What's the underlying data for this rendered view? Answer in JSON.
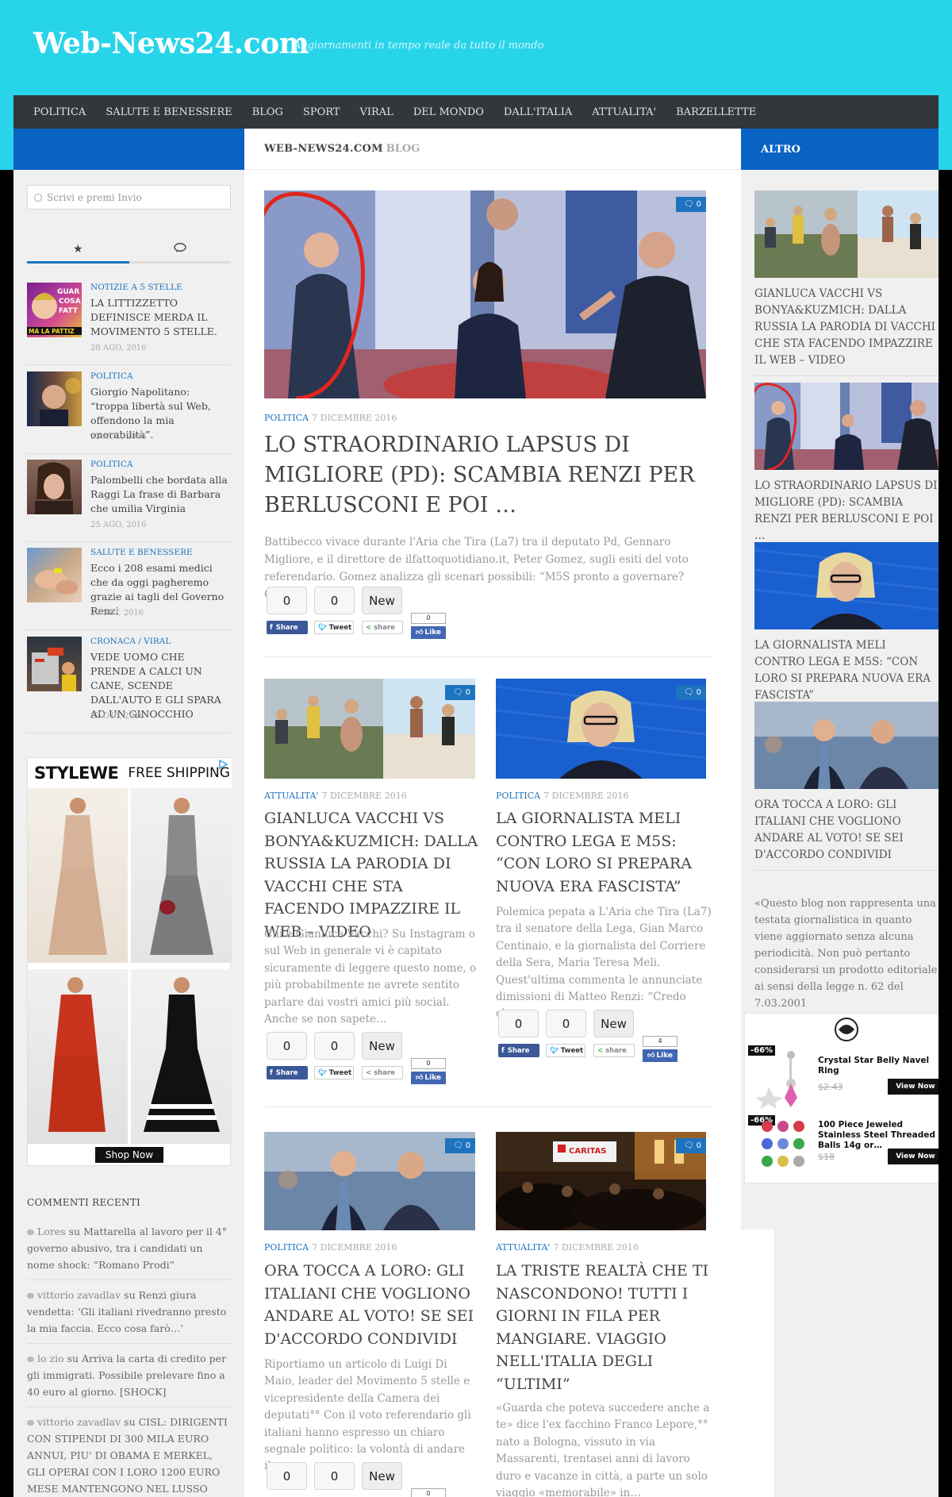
{
  "site": {
    "title": "Web-News24.com",
    "tagline": "Aggiornamenti in tempo reale da tutto il mondo"
  },
  "nav": [
    "POLITICA",
    "SALUTE E BENESSERE",
    "BLOG",
    "SPORT",
    "VIRAL",
    "DEL MONDO",
    "DALL'ITALIA",
    "ATTUALITA'",
    "BARZELLETTE"
  ],
  "main_header": {
    "site": "WEB-NEWS24.COM",
    "section": "BLOG"
  },
  "right_header": "ALTRO",
  "search": {
    "placeholder": "Scrivi e premi Invio"
  },
  "sidebar_posts": [
    {
      "category": "NOTIZIE A 5 STELLE",
      "title": "LA LITTIZZETTO DEFINISCE MERDA IL MOVIMENTO 5 STELLE.",
      "date": "28 AGO, 2016"
    },
    {
      "category": "POLITICA",
      "title": "Giorgio Napolitano: “troppa libertà sul Web, offendono la mia onorabilità”.",
      "date": "23 AGO, 2016"
    },
    {
      "category": "POLITICA",
      "title": "Palombelli che bordata alla Raggi La frase di Barbara che umilia Virginia",
      "date": "25 AGO, 2016"
    },
    {
      "category": "SALUTE E BENESSERE",
      "title": "Ecco i 208 esami medici che da oggi pagheremo grazie ai tagli del Governo Renzi",
      "date": "24 SET, 2016"
    },
    {
      "category": "CRONACA",
      "category2": "VIRAL",
      "title": "VEDE UOMO CHE PRENDE A CALCI UN CANE, SCENDE DALL'AUTO E GLI SPARA AD UN GINOCCHIO",
      "date": "27 OTT, 2016"
    }
  ],
  "ad_left": {
    "brand": "STYLEWE",
    "headline": "FREE SHIPPING",
    "cta": "Shop Now"
  },
  "recent_comments": {
    "heading": "COMMENTI RECENTI",
    "items": [
      {
        "author": "Lores",
        "sep": "su",
        "post": "Mattarella al lavoro per il 4° governo abusivo, tra i candidati un nome shock: “Romano Prodi”"
      },
      {
        "author": "vittorio zavadlav",
        "sep": "su",
        "post": "Renzi giura vendetta: ‘Gli italiani rivedranno presto la mia faccia. Ecco cosa farò…’"
      },
      {
        "author": "lo zio",
        "sep": "su",
        "post": "Arriva la carta di credito per gli immigrati. Possibile prelevare fino a 40 euro al giorno. [SHOCK]"
      },
      {
        "author": "vittorio zavadlav",
        "sep": "su",
        "post": "CISL: DIRIGENTI CON STIPENDI DI 300 MILA EURO ANNUI, PIU' DI OBAMA E MERKEL, GLI OPERAI CON I LORO 1200 EURO MESE MANTENGONO NEL LUSSO CHI"
      }
    ]
  },
  "posts": [
    {
      "comments": "0",
      "category": "POLITICA",
      "date": "7 DICEMBRE 2016",
      "title": "LO STRAORDINARIO LAPSUS DI MIGLIORE (PD): SCAMBIA RENZI PER BERLUSCONI E POI …",
      "excerpt": "Battibecco vivace durante l'Aria che Tira (La7) tra il deputato Pd, Gennaro Migliore, e il direttore de ilfattoquotidiano.it, Peter Gomez, sugli esiti del voto referendario. Gomez analizza gli scenari possibili: “M5S pronto a governare? Ora…",
      "share": {
        "c1": "0",
        "c2": "0",
        "new": "New",
        "fb": "Share",
        "tw": "Tweet",
        "sh": "share",
        "likes": "0",
        "like": "Like"
      }
    },
    {
      "comments": "0",
      "category": "ATTUALITA'",
      "date": "7 DICEMBRE 2016",
      "title": "GIANLUCA VACCHI VS BONYA&KUZMICH: DALLA RUSSIA LA PARODIA DI VACCHI CHE STA FACENDO IMPAZZIRE IL WEB – VIDEO",
      "excerpt": "Chi è Gianluca Vacchi? Su Instagram o sul Web in generale vi è capitato sicuramente di leggere questo nome, o più probabilmente ne avrete sentito parlare dai vostri amici più social. Anche se non sapete…",
      "share": {
        "c1": "0",
        "c2": "0",
        "new": "New",
        "fb": "Share",
        "tw": "Tweet",
        "sh": "share",
        "likes": "0",
        "like": "Like"
      }
    },
    {
      "comments": "0",
      "category": "POLITICA",
      "date": "7 DICEMBRE 2016",
      "title": "LA GIORNALISTA MELI CONTRO LEGA E M5S: “CON LORO SI PREPARA NUOVA ERA FASCISTA”",
      "excerpt": "Polemica pepata a L'Aria che Tira (La7) tra il senatore della Lega, Gian Marco Centinaio, e la giornalista del Corriere della Sera, Maria Teresa Meli. Quest'ultima commenta le annunciate dimissioni di Matteo Renzi: “Credo che…",
      "share": {
        "c1": "0",
        "c2": "0",
        "new": "New",
        "fb": "Share",
        "tw": "Tweet",
        "sh": "share",
        "likes": "4",
        "like": "Like"
      }
    },
    {
      "comments": "0",
      "category": "POLITICA",
      "date": "7 DICEMBRE 2016",
      "title": "ORA TOCCA A LORO: GLI ITALIANI CHE VOGLIONO ANDARE AL VOTO! SE SEI D'ACCORDO CONDIVIDI",
      "excerpt": "Riportiamo un articolo di Luigi Di Maio, leader del Movimento 5 stelle e vicepresidente della Camera dei deputati°° Con il voto referendario gli italiani hanno espresso un chiaro segnale politico: la volontà di andare il…",
      "share": {
        "c1": "0",
        "c2": "0",
        "new": "New",
        "likes": "0"
      }
    },
    {
      "comments": "0",
      "category": "ATTUALITA'",
      "date": "7 DICEMBRE 2016",
      "title": "LA TRISTE REALTÀ CHE TI NASCONDONO! TUTTI I GIORNI IN FILA PER MANGIARE. VIAGGIO NELL'ITALIA DEGLI “ULTIMI”",
      "excerpt": "«Guarda che poteva succedere anche a te» dice l'ex facchino Franco Lepore,°° nato a Bologna, vissuto in via Massarenti, trentasei anni di lavoro duro e vacanze in città, a parte un solo viaggio «memorabile» in…"
    }
  ],
  "right_posts": [
    {
      "title": "GIANLUCA VACCHI VS BONYA&KUZMICH: DALLA RUSSIA LA PARODIA DI VACCHI CHE STA FACENDO IMPAZZIRE IL WEB – VIDEO"
    },
    {
      "title": "LO STRAORDINARIO LAPSUS DI MIGLIORE (PD): SCAMBIA RENZI PER BERLUSCONI E POI …"
    },
    {
      "title": "LA GIORNALISTA MELI CONTRO LEGA E M5S: “CON LORO SI PREPARA NUOVA ERA FASCISTA”"
    },
    {
      "title": "ORA TOCCA A LORO: GLI ITALIANI CHE VOGLIONO ANDARE AL VOTO! SE SEI D'ACCORDO CONDIVIDI"
    }
  ],
  "disclaimer": "«Questo blog non rappresenta una testata giornalistica in quanto viene aggiornato senza alcuna periodicità. Non può pertanto considerarsi un prodotto editoriale ai sensi della legge n. 62 del 7.03.2001",
  "ad_right": {
    "items": [
      {
        "discount": "-66%",
        "name": "Crystal Star Belly Navel Ring",
        "price": "$2.43",
        "cta": "View Now"
      },
      {
        "discount": "-66%",
        "name": "100 Piece Jeweled Stainless Steel Threaded Balls 14g or…",
        "price": "$18",
        "cta": "View Now"
      }
    ]
  },
  "colors": {
    "header_bg": "#28d4ea",
    "nav_bg": "#33363b",
    "accent": "#1e73be",
    "section_bar": "#0a62c3"
  }
}
